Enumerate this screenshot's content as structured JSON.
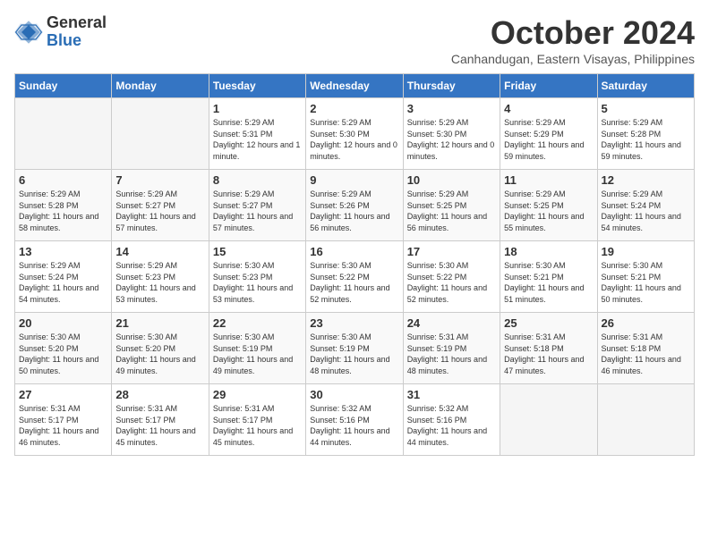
{
  "logo": {
    "general": "General",
    "blue": "Blue"
  },
  "title": "October 2024",
  "subtitle": "Canhandugan, Eastern Visayas, Philippines",
  "headers": [
    "Sunday",
    "Monday",
    "Tuesday",
    "Wednesday",
    "Thursday",
    "Friday",
    "Saturday"
  ],
  "weeks": [
    [
      {
        "day": "",
        "info": ""
      },
      {
        "day": "",
        "info": ""
      },
      {
        "day": "1",
        "info": "Sunrise: 5:29 AM\nSunset: 5:31 PM\nDaylight: 12 hours\nand 1 minute."
      },
      {
        "day": "2",
        "info": "Sunrise: 5:29 AM\nSunset: 5:30 PM\nDaylight: 12 hours\nand 0 minutes."
      },
      {
        "day": "3",
        "info": "Sunrise: 5:29 AM\nSunset: 5:30 PM\nDaylight: 12 hours\nand 0 minutes."
      },
      {
        "day": "4",
        "info": "Sunrise: 5:29 AM\nSunset: 5:29 PM\nDaylight: 11 hours\nand 59 minutes."
      },
      {
        "day": "5",
        "info": "Sunrise: 5:29 AM\nSunset: 5:28 PM\nDaylight: 11 hours\nand 59 minutes."
      }
    ],
    [
      {
        "day": "6",
        "info": "Sunrise: 5:29 AM\nSunset: 5:28 PM\nDaylight: 11 hours\nand 58 minutes."
      },
      {
        "day": "7",
        "info": "Sunrise: 5:29 AM\nSunset: 5:27 PM\nDaylight: 11 hours\nand 57 minutes."
      },
      {
        "day": "8",
        "info": "Sunrise: 5:29 AM\nSunset: 5:27 PM\nDaylight: 11 hours\nand 57 minutes."
      },
      {
        "day": "9",
        "info": "Sunrise: 5:29 AM\nSunset: 5:26 PM\nDaylight: 11 hours\nand 56 minutes."
      },
      {
        "day": "10",
        "info": "Sunrise: 5:29 AM\nSunset: 5:25 PM\nDaylight: 11 hours\nand 56 minutes."
      },
      {
        "day": "11",
        "info": "Sunrise: 5:29 AM\nSunset: 5:25 PM\nDaylight: 11 hours\nand 55 minutes."
      },
      {
        "day": "12",
        "info": "Sunrise: 5:29 AM\nSunset: 5:24 PM\nDaylight: 11 hours\nand 54 minutes."
      }
    ],
    [
      {
        "day": "13",
        "info": "Sunrise: 5:29 AM\nSunset: 5:24 PM\nDaylight: 11 hours\nand 54 minutes."
      },
      {
        "day": "14",
        "info": "Sunrise: 5:29 AM\nSunset: 5:23 PM\nDaylight: 11 hours\nand 53 minutes."
      },
      {
        "day": "15",
        "info": "Sunrise: 5:30 AM\nSunset: 5:23 PM\nDaylight: 11 hours\nand 53 minutes."
      },
      {
        "day": "16",
        "info": "Sunrise: 5:30 AM\nSunset: 5:22 PM\nDaylight: 11 hours\nand 52 minutes."
      },
      {
        "day": "17",
        "info": "Sunrise: 5:30 AM\nSunset: 5:22 PM\nDaylight: 11 hours\nand 52 minutes."
      },
      {
        "day": "18",
        "info": "Sunrise: 5:30 AM\nSunset: 5:21 PM\nDaylight: 11 hours\nand 51 minutes."
      },
      {
        "day": "19",
        "info": "Sunrise: 5:30 AM\nSunset: 5:21 PM\nDaylight: 11 hours\nand 50 minutes."
      }
    ],
    [
      {
        "day": "20",
        "info": "Sunrise: 5:30 AM\nSunset: 5:20 PM\nDaylight: 11 hours\nand 50 minutes."
      },
      {
        "day": "21",
        "info": "Sunrise: 5:30 AM\nSunset: 5:20 PM\nDaylight: 11 hours\nand 49 minutes."
      },
      {
        "day": "22",
        "info": "Sunrise: 5:30 AM\nSunset: 5:19 PM\nDaylight: 11 hours\nand 49 minutes."
      },
      {
        "day": "23",
        "info": "Sunrise: 5:30 AM\nSunset: 5:19 PM\nDaylight: 11 hours\nand 48 minutes."
      },
      {
        "day": "24",
        "info": "Sunrise: 5:31 AM\nSunset: 5:19 PM\nDaylight: 11 hours\nand 48 minutes."
      },
      {
        "day": "25",
        "info": "Sunrise: 5:31 AM\nSunset: 5:18 PM\nDaylight: 11 hours\nand 47 minutes."
      },
      {
        "day": "26",
        "info": "Sunrise: 5:31 AM\nSunset: 5:18 PM\nDaylight: 11 hours\nand 46 minutes."
      }
    ],
    [
      {
        "day": "27",
        "info": "Sunrise: 5:31 AM\nSunset: 5:17 PM\nDaylight: 11 hours\nand 46 minutes."
      },
      {
        "day": "28",
        "info": "Sunrise: 5:31 AM\nSunset: 5:17 PM\nDaylight: 11 hours\nand 45 minutes."
      },
      {
        "day": "29",
        "info": "Sunrise: 5:31 AM\nSunset: 5:17 PM\nDaylight: 11 hours\nand 45 minutes."
      },
      {
        "day": "30",
        "info": "Sunrise: 5:32 AM\nSunset: 5:16 PM\nDaylight: 11 hours\nand 44 minutes."
      },
      {
        "day": "31",
        "info": "Sunrise: 5:32 AM\nSunset: 5:16 PM\nDaylight: 11 hours\nand 44 minutes."
      },
      {
        "day": "",
        "info": ""
      },
      {
        "day": "",
        "info": ""
      }
    ]
  ]
}
